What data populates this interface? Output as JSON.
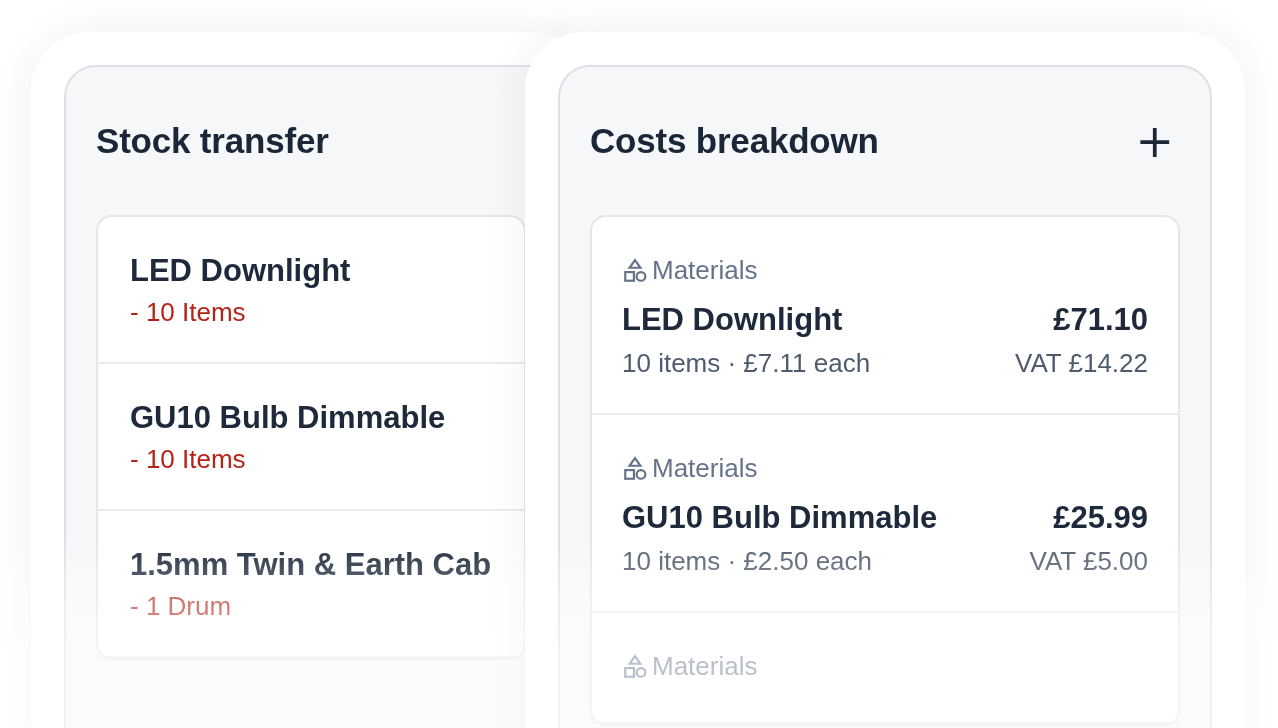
{
  "stock_transfer": {
    "title": "Stock transfer",
    "items": [
      {
        "name": "LED Downlight",
        "quantity": "- 10 Items"
      },
      {
        "name": "GU10 Bulb Dimmable",
        "quantity": "- 10 Items"
      },
      {
        "name": "1.5mm Twin & Earth Cab",
        "quantity": "- 1 Drum"
      }
    ]
  },
  "costs_breakdown": {
    "title": "Costs breakdown",
    "add_button": "+",
    "items": [
      {
        "category": "Materials",
        "name": "LED Downlight",
        "price": "£71.10",
        "detail": "10 items · £7.11 each",
        "vat": "VAT £14.22"
      },
      {
        "category": "Materials",
        "name": "GU10 Bulb Dimmable",
        "price": "£25.99",
        "detail": "10 items · £2.50 each",
        "vat": "VAT £5.00"
      },
      {
        "category": "Materials"
      }
    ]
  }
}
